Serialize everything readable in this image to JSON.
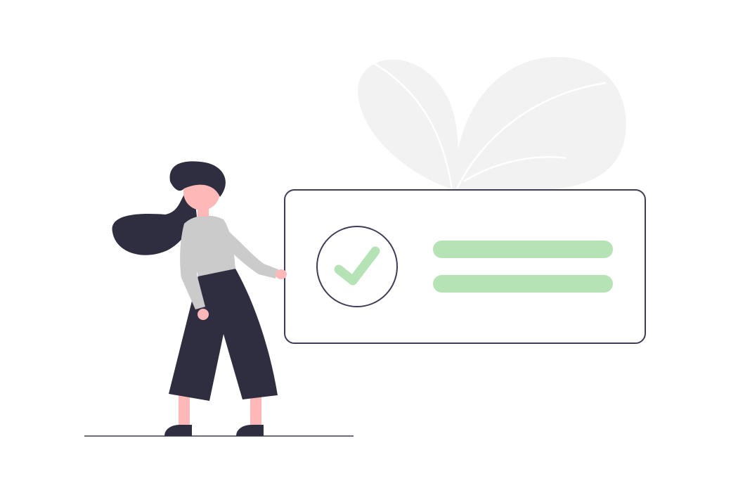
{
  "illustration": {
    "subject": "woman-presenting-confirmation-card",
    "icons": [
      "leaf-icon",
      "check-icon"
    ],
    "colors": {
      "background": "#ffffff",
      "leaves": "#f2f2f2",
      "leaf_veins": "#ffffff",
      "card_stroke": "#3f3d56",
      "card_fill": "#ffffff",
      "check_stroke": "#3f3d56",
      "check_mark": "#b6e3b5",
      "text_placeholder": "#b6e3b5",
      "hair": "#2f2e41",
      "skin": "#ffb8b8",
      "shirt": "#cbcbcb",
      "pants": "#2f2e41",
      "shoes": "#2f2e41",
      "ground": "#3f3d56"
    }
  }
}
